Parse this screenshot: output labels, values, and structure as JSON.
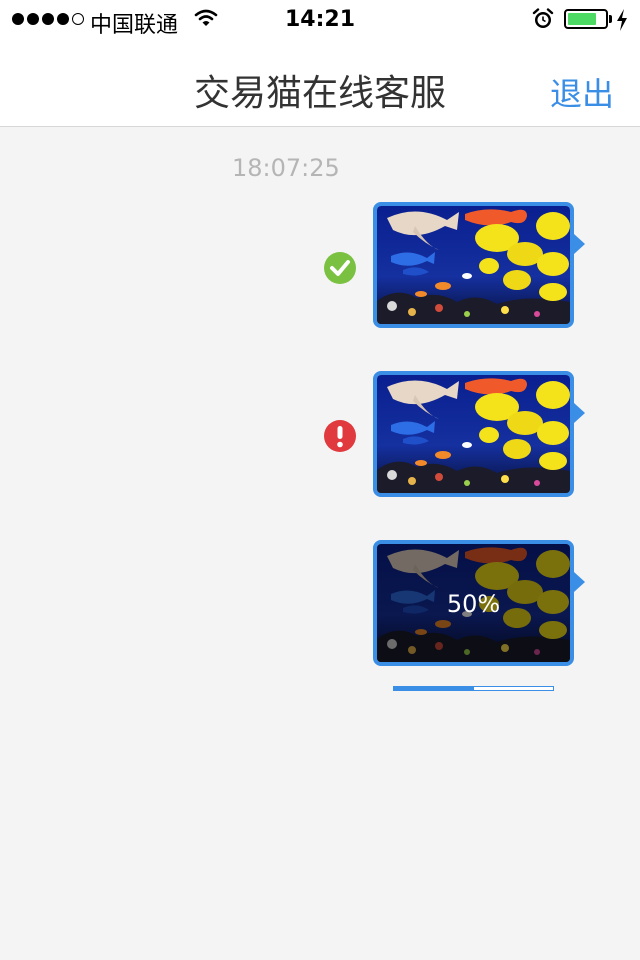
{
  "status_bar": {
    "carrier": "中国联通",
    "time": "14:21",
    "signal_bars_filled": 4,
    "signal_bars_total": 5,
    "battery_fraction": 0.78,
    "icons": [
      "wifi-icon",
      "alarm-icon",
      "battery-icon",
      "charging-bolt-icon"
    ]
  },
  "header": {
    "title": "交易猫在线客服",
    "exit_label": "退出"
  },
  "chat": {
    "timestamp": "18:07:25",
    "messages": [
      {
        "type": "image",
        "status": "sent",
        "status_icon": "check-circle-icon",
        "status_color": "#7ac142"
      },
      {
        "type": "image",
        "status": "failed",
        "status_icon": "exclamation-circle-icon",
        "status_color": "#e0393e"
      },
      {
        "type": "image",
        "status": "uploading",
        "progress_label": "50%",
        "progress": 0.5
      }
    ]
  },
  "colors": {
    "accent": "#3a8ee6",
    "background": "#f4f4f4",
    "timestamp": "#b5b5b5"
  }
}
